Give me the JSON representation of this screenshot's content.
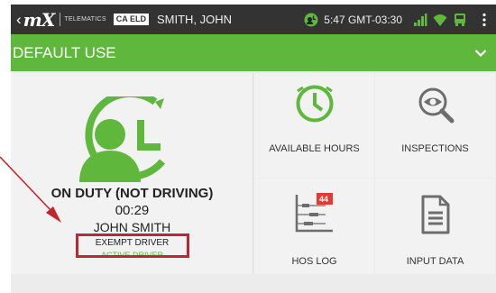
{
  "status_bar": {
    "logo": "mX",
    "telematics_label": "TELEMATICS",
    "eld_badge": "CA ELD",
    "driver_name": "SMITH, JOHN",
    "time": "5:47 GMT-03:30"
  },
  "title_bar": {
    "title": "DEFAULT USE"
  },
  "status_card": {
    "duty_status": "ON DUTY (NOT DRIVING)",
    "duty_time": "00:29",
    "driver_name": "JOHN SMITH",
    "exemption": "EXEMPT DRIVER",
    "role": "ACTIVE DRIVER"
  },
  "tiles": [
    {
      "label": "AVAILABLE HOURS",
      "icon": "clock-icon"
    },
    {
      "label": "INSPECTIONS",
      "icon": "magnifier-eye-icon"
    },
    {
      "label": "HOS LOG",
      "icon": "log-chart-icon",
      "badge": "44"
    },
    {
      "label": "INPUT DATA",
      "icon": "document-icon"
    }
  ],
  "colors": {
    "brand_green": "#5fb83c",
    "status_bar": "#333333",
    "badge_red": "#e53935",
    "annotation_red": "#c0262c"
  }
}
